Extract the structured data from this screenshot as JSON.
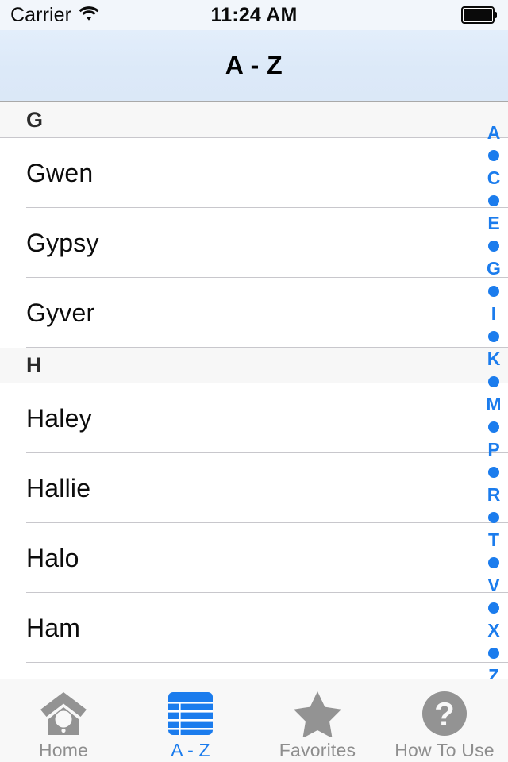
{
  "status_bar": {
    "carrier": "Carrier",
    "wifi_icon": "wifi-icon",
    "time": "11:24 AM",
    "battery_icon": "battery-full-icon"
  },
  "nav": {
    "title": "A - Z"
  },
  "colors": {
    "accent_blue": "#1b7ced",
    "nav_background": "#dce9f8",
    "section_header_background": "#f7f7f7",
    "separator": "#c8c7cc",
    "inactive_tab": "#8e8e8e",
    "tabbar_background": "#f8f8f8"
  },
  "list": {
    "sections": [
      {
        "title": "G",
        "rows": [
          {
            "name": "Gwen"
          },
          {
            "name": "Gypsy"
          },
          {
            "name": "Gyver"
          }
        ]
      },
      {
        "title": "H",
        "rows": [
          {
            "name": "Haley"
          },
          {
            "name": "Hallie"
          },
          {
            "name": "Halo"
          },
          {
            "name": "Ham"
          }
        ]
      }
    ]
  },
  "index_strip": {
    "items": [
      {
        "type": "letter",
        "label": "A"
      },
      {
        "type": "dot",
        "label": "•"
      },
      {
        "type": "letter",
        "label": "C"
      },
      {
        "type": "dot",
        "label": "•"
      },
      {
        "type": "letter",
        "label": "E"
      },
      {
        "type": "dot",
        "label": "•"
      },
      {
        "type": "letter",
        "label": "G"
      },
      {
        "type": "dot",
        "label": "•"
      },
      {
        "type": "letter",
        "label": "I"
      },
      {
        "type": "dot",
        "label": "•"
      },
      {
        "type": "letter",
        "label": "K"
      },
      {
        "type": "dot",
        "label": "•"
      },
      {
        "type": "letter",
        "label": "M"
      },
      {
        "type": "dot",
        "label": "•"
      },
      {
        "type": "letter",
        "label": "P"
      },
      {
        "type": "dot",
        "label": "•"
      },
      {
        "type": "letter",
        "label": "R"
      },
      {
        "type": "dot",
        "label": "•"
      },
      {
        "type": "letter",
        "label": "T"
      },
      {
        "type": "dot",
        "label": "•"
      },
      {
        "type": "letter",
        "label": "V"
      },
      {
        "type": "dot",
        "label": "•"
      },
      {
        "type": "letter",
        "label": "X"
      },
      {
        "type": "dot",
        "label": "•"
      },
      {
        "type": "letter",
        "label": "Z"
      },
      {
        "type": "letter",
        "label": "#"
      }
    ]
  },
  "tabbar": {
    "tabs": [
      {
        "label": "Home",
        "icon": "birdhouse-icon",
        "active": false
      },
      {
        "label": "A - Z",
        "icon": "table-list-icon",
        "active": true
      },
      {
        "label": "Favorites",
        "icon": "star-icon",
        "active": false
      },
      {
        "label": "How To Use",
        "icon": "question-circle-icon",
        "active": false
      }
    ]
  }
}
